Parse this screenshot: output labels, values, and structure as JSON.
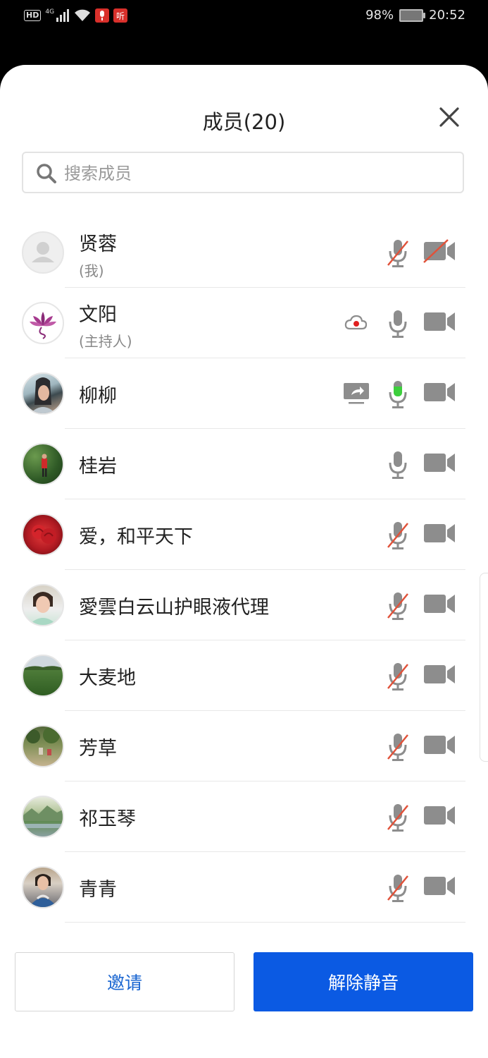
{
  "status_bar": {
    "hd": "HD",
    "network": "4G",
    "listen_badge": "听",
    "battery": "98%",
    "time": "20:52"
  },
  "panel": {
    "title": "成员(20)"
  },
  "search": {
    "placeholder": "搜索成员",
    "value": ""
  },
  "members": [
    {
      "name": "贤蓉",
      "sub": "(我)",
      "mic": "muted",
      "camera": "off",
      "avatar": "default-avatar"
    },
    {
      "name": "文阳",
      "sub": "(主持人)",
      "mic": "on",
      "camera": "on",
      "recording": true,
      "avatar": "lotus-logo"
    },
    {
      "name": "柳柳",
      "mic": "speaking",
      "camera": "on",
      "screen_share": true,
      "avatar": "photo-woman"
    },
    {
      "name": "桂岩",
      "mic": "on",
      "camera": "on",
      "avatar": "photo-garden"
    },
    {
      "name": "爱，和平天下",
      "mic": "muted",
      "camera": "on",
      "avatar": "photo-red-rose"
    },
    {
      "name": "愛雲白云山护眼液代理",
      "mic": "muted",
      "camera": "on",
      "avatar": "photo-woman-smile"
    },
    {
      "name": "大麦地",
      "mic": "muted",
      "camera": "on",
      "avatar": "photo-field"
    },
    {
      "name": "芳草",
      "mic": "muted",
      "camera": "on",
      "avatar": "photo-park"
    },
    {
      "name": "祁玉琴",
      "mic": "muted",
      "camera": "on",
      "avatar": "photo-landscape"
    },
    {
      "name": "青青",
      "mic": "muted",
      "camera": "on",
      "avatar": "photo-lady"
    }
  ],
  "buttons": {
    "invite": "邀请",
    "unmute_all": "解除静音"
  },
  "colors": {
    "primary": "#0b5ae3",
    "link_blue": "#1a66d1",
    "mute_slash": "#e0523a",
    "speaking_green": "#3ccf3c",
    "record_red": "#e02020",
    "icon_gray": "#8d8d8d"
  }
}
